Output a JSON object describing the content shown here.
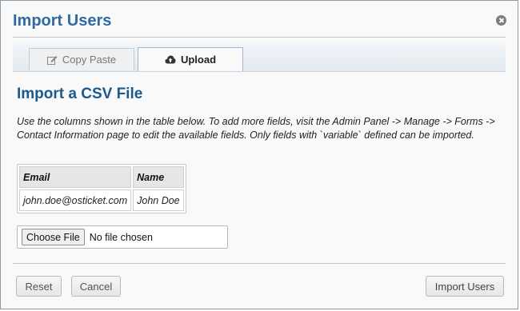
{
  "dialog": {
    "title": "Import Users",
    "close_icon": "close-circle-icon"
  },
  "tabs": [
    {
      "label": "Copy Paste",
      "icon": "edit-icon",
      "active": false
    },
    {
      "label": "Upload",
      "icon": "cloud-upload-icon",
      "active": true
    }
  ],
  "content": {
    "heading": "Import a CSV File",
    "description": "Use the columns shown in the table below. To add more fields, visit the Admin Panel -> Manage -> Forms -> Contact Information page to edit the available fields. Only fields with `variable` defined can be imported."
  },
  "table": {
    "headers": [
      "Email",
      "Name"
    ],
    "rows": [
      [
        "john.doe@osticket.com",
        "John Doe"
      ]
    ]
  },
  "file_input": {
    "button_label": "Choose File",
    "status": "No file chosen"
  },
  "footer": {
    "reset_label": "Reset",
    "cancel_label": "Cancel",
    "import_label": "Import Users"
  },
  "colors": {
    "title": "#2f6aa3",
    "heading": "#1b5a8e"
  }
}
